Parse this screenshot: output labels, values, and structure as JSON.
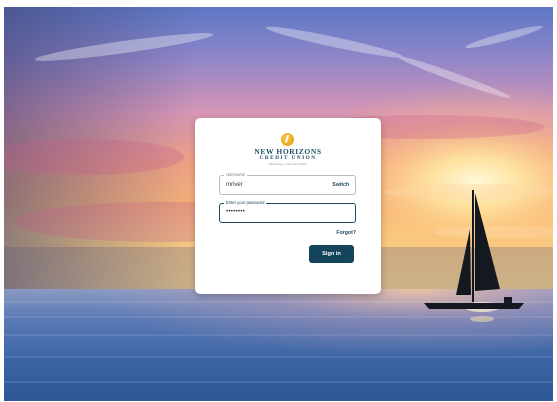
{
  "brand": {
    "name_line1": "NEW HORIZONS",
    "name_line2": "CREDIT UNION",
    "tagline": "Delivering on the New World"
  },
  "login": {
    "username_label": "Username",
    "username_value": "mriver",
    "switch_label": "Switch",
    "password_label": "Enter your password",
    "password_value": "••••••••",
    "forgot_label": "Forgot?",
    "signin_label": "Sign in"
  },
  "colors": {
    "accent": "#14455c",
    "logo_gold": "#e9a81c"
  },
  "icons": {
    "logo": "sun-sail-logo-icon"
  }
}
